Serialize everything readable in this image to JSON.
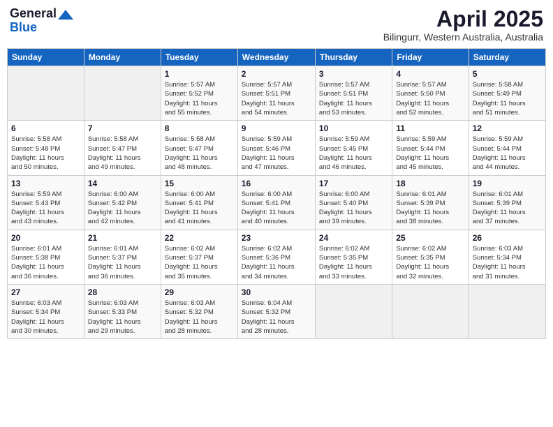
{
  "header": {
    "logo_line1": "General",
    "logo_line2": "Blue",
    "title": "April 2025",
    "subtitle": "Bilingurr, Western Australia, Australia"
  },
  "columns": [
    "Sunday",
    "Monday",
    "Tuesday",
    "Wednesday",
    "Thursday",
    "Friday",
    "Saturday"
  ],
  "weeks": [
    [
      {
        "day": "",
        "detail": ""
      },
      {
        "day": "",
        "detail": ""
      },
      {
        "day": "1",
        "detail": "Sunrise: 5:57 AM\nSunset: 5:52 PM\nDaylight: 11 hours\nand 55 minutes."
      },
      {
        "day": "2",
        "detail": "Sunrise: 5:57 AM\nSunset: 5:51 PM\nDaylight: 11 hours\nand 54 minutes."
      },
      {
        "day": "3",
        "detail": "Sunrise: 5:57 AM\nSunset: 5:51 PM\nDaylight: 11 hours\nand 53 minutes."
      },
      {
        "day": "4",
        "detail": "Sunrise: 5:57 AM\nSunset: 5:50 PM\nDaylight: 11 hours\nand 52 minutes."
      },
      {
        "day": "5",
        "detail": "Sunrise: 5:58 AM\nSunset: 5:49 PM\nDaylight: 11 hours\nand 51 minutes."
      }
    ],
    [
      {
        "day": "6",
        "detail": "Sunrise: 5:58 AM\nSunset: 5:48 PM\nDaylight: 11 hours\nand 50 minutes."
      },
      {
        "day": "7",
        "detail": "Sunrise: 5:58 AM\nSunset: 5:47 PM\nDaylight: 11 hours\nand 49 minutes."
      },
      {
        "day": "8",
        "detail": "Sunrise: 5:58 AM\nSunset: 5:47 PM\nDaylight: 11 hours\nand 48 minutes."
      },
      {
        "day": "9",
        "detail": "Sunrise: 5:59 AM\nSunset: 5:46 PM\nDaylight: 11 hours\nand 47 minutes."
      },
      {
        "day": "10",
        "detail": "Sunrise: 5:59 AM\nSunset: 5:45 PM\nDaylight: 11 hours\nand 46 minutes."
      },
      {
        "day": "11",
        "detail": "Sunrise: 5:59 AM\nSunset: 5:44 PM\nDaylight: 11 hours\nand 45 minutes."
      },
      {
        "day": "12",
        "detail": "Sunrise: 5:59 AM\nSunset: 5:44 PM\nDaylight: 11 hours\nand 44 minutes."
      }
    ],
    [
      {
        "day": "13",
        "detail": "Sunrise: 5:59 AM\nSunset: 5:43 PM\nDaylight: 11 hours\nand 43 minutes."
      },
      {
        "day": "14",
        "detail": "Sunrise: 6:00 AM\nSunset: 5:42 PM\nDaylight: 11 hours\nand 42 minutes."
      },
      {
        "day": "15",
        "detail": "Sunrise: 6:00 AM\nSunset: 5:41 PM\nDaylight: 11 hours\nand 41 minutes."
      },
      {
        "day": "16",
        "detail": "Sunrise: 6:00 AM\nSunset: 5:41 PM\nDaylight: 11 hours\nand 40 minutes."
      },
      {
        "day": "17",
        "detail": "Sunrise: 6:00 AM\nSunset: 5:40 PM\nDaylight: 11 hours\nand 39 minutes."
      },
      {
        "day": "18",
        "detail": "Sunrise: 6:01 AM\nSunset: 5:39 PM\nDaylight: 11 hours\nand 38 minutes."
      },
      {
        "day": "19",
        "detail": "Sunrise: 6:01 AM\nSunset: 5:39 PM\nDaylight: 11 hours\nand 37 minutes."
      }
    ],
    [
      {
        "day": "20",
        "detail": "Sunrise: 6:01 AM\nSunset: 5:38 PM\nDaylight: 11 hours\nand 36 minutes."
      },
      {
        "day": "21",
        "detail": "Sunrise: 6:01 AM\nSunset: 5:37 PM\nDaylight: 11 hours\nand 36 minutes."
      },
      {
        "day": "22",
        "detail": "Sunrise: 6:02 AM\nSunset: 5:37 PM\nDaylight: 11 hours\nand 35 minutes."
      },
      {
        "day": "23",
        "detail": "Sunrise: 6:02 AM\nSunset: 5:36 PM\nDaylight: 11 hours\nand 34 minutes."
      },
      {
        "day": "24",
        "detail": "Sunrise: 6:02 AM\nSunset: 5:35 PM\nDaylight: 11 hours\nand 33 minutes."
      },
      {
        "day": "25",
        "detail": "Sunrise: 6:02 AM\nSunset: 5:35 PM\nDaylight: 11 hours\nand 32 minutes."
      },
      {
        "day": "26",
        "detail": "Sunrise: 6:03 AM\nSunset: 5:34 PM\nDaylight: 11 hours\nand 31 minutes."
      }
    ],
    [
      {
        "day": "27",
        "detail": "Sunrise: 6:03 AM\nSunset: 5:34 PM\nDaylight: 11 hours\nand 30 minutes."
      },
      {
        "day": "28",
        "detail": "Sunrise: 6:03 AM\nSunset: 5:33 PM\nDaylight: 11 hours\nand 29 minutes."
      },
      {
        "day": "29",
        "detail": "Sunrise: 6:03 AM\nSunset: 5:32 PM\nDaylight: 11 hours\nand 28 minutes."
      },
      {
        "day": "30",
        "detail": "Sunrise: 6:04 AM\nSunset: 5:32 PM\nDaylight: 11 hours\nand 28 minutes."
      },
      {
        "day": "",
        "detail": ""
      },
      {
        "day": "",
        "detail": ""
      },
      {
        "day": "",
        "detail": ""
      }
    ]
  ]
}
